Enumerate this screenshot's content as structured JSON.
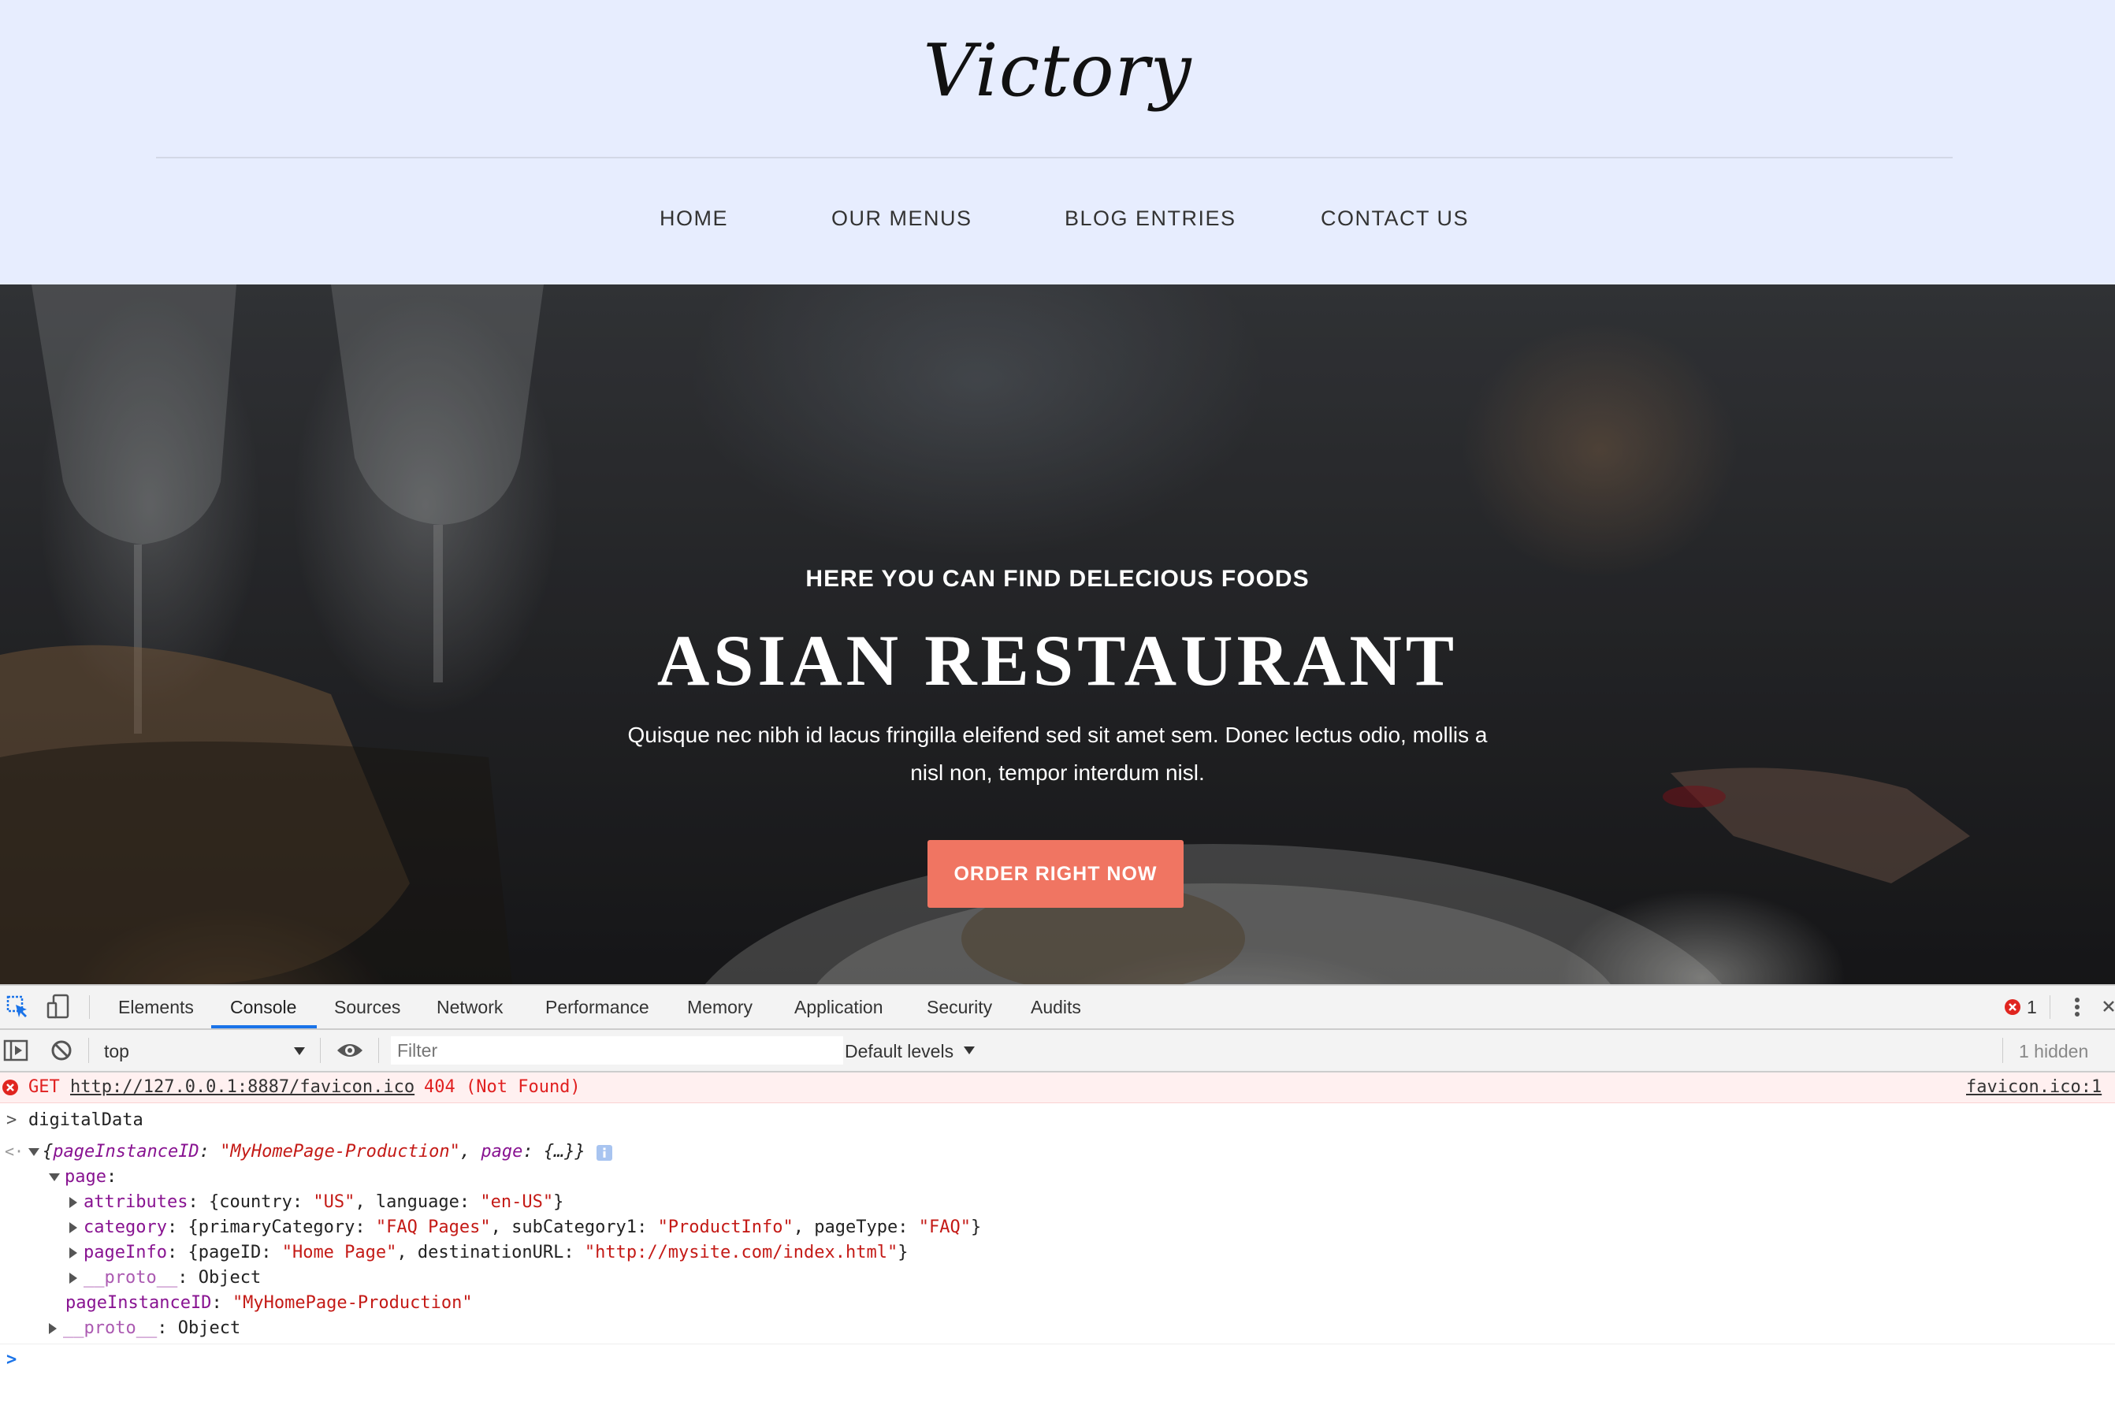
{
  "site": {
    "logo": "Victory",
    "nav": [
      "HOME",
      "OUR MENUS",
      "BLOG ENTRIES",
      "CONTACT US"
    ]
  },
  "hero": {
    "subtitle": "HERE YOU CAN FIND DELECIOUS FOODS",
    "title": "ASIAN RESTAURANT",
    "text": "Quisque nec nibh id lacus fringilla eleifend sed sit amet sem. Donec lectus odio, mollis a nisl non, tempor interdum nisl.",
    "button": "ORDER RIGHT NOW",
    "button_color": "#f07562"
  },
  "devtools": {
    "tabs": [
      "Elements",
      "Console",
      "Sources",
      "Network",
      "Performance",
      "Memory",
      "Application",
      "Security",
      "Audits"
    ],
    "active_tab": "Console",
    "error_count": "1",
    "context": "top",
    "filter_placeholder": "Filter",
    "levels": "Default levels",
    "hidden": "1 hidden",
    "console": {
      "error": {
        "method": "GET",
        "url": "http://127.0.0.1:8887/favicon.ico",
        "status": "404 (Not Found)",
        "source": "favicon.ico:1"
      },
      "input": "digitalData",
      "result": {
        "summary_open": "{",
        "summary_k1": "pageInstanceID",
        "summary_v1": "\"MyHomePage-Production\"",
        "summary_k2": "page",
        "summary_v2": "{…}}",
        "page_key": "page",
        "attributes_key": "attributes",
        "attributes_country_key": "country",
        "attributes_country": "\"US\"",
        "attributes_language_key": "language",
        "attributes_language": "\"en-US\"",
        "category_key": "category",
        "category_primary_key": "primaryCategory",
        "category_primary": "\"FAQ Pages\"",
        "category_sub_key": "subCategory1",
        "category_sub": "\"ProductInfo\"",
        "category_type_key": "pageType",
        "category_type": "\"FAQ\"",
        "pageinfo_key": "pageInfo",
        "pageinfo_id_key": "pageID",
        "pageinfo_id": "\"Home Page\"",
        "pageinfo_url_key": "destinationURL",
        "pageinfo_url": "\"http://mysite.com/index.html\"",
        "proto_key": "__proto__",
        "proto_value": "Object",
        "instance_key": "pageInstanceID",
        "instance_value": "\"MyHomePage-Production\""
      }
    }
  }
}
